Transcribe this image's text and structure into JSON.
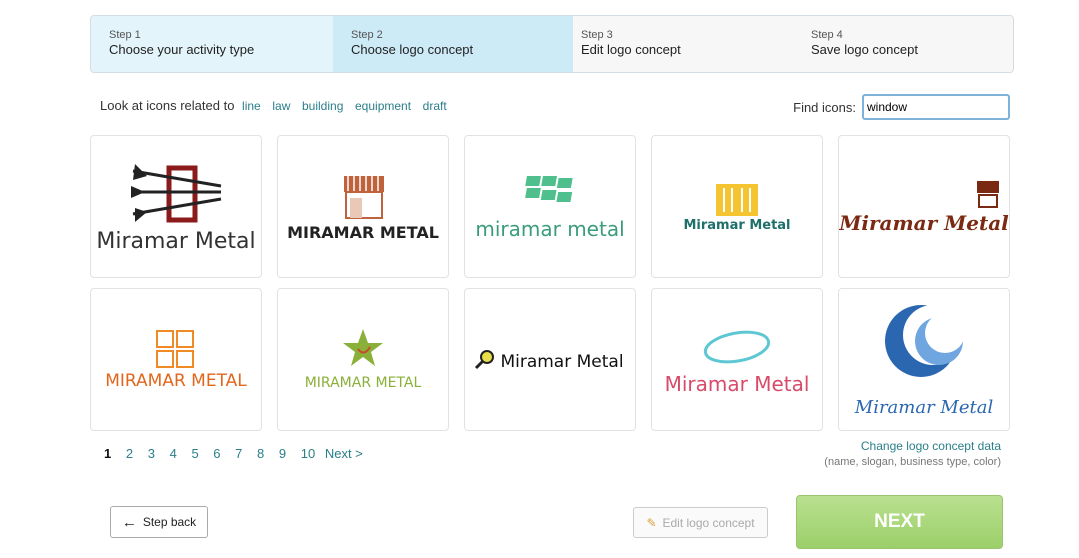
{
  "steps": [
    {
      "num": "Step 1",
      "label": "Choose your activity type"
    },
    {
      "num": "Step 2",
      "label": "Choose logo concept"
    },
    {
      "num": "Step 3",
      "label": "Edit logo concept"
    },
    {
      "num": "Step 4",
      "label": "Save logo concept"
    }
  ],
  "related": {
    "prefix": "Look at icons related to",
    "tags": [
      "line",
      "law",
      "building",
      "equipment",
      "draft"
    ]
  },
  "find": {
    "label": "Find icons:",
    "value": "window"
  },
  "logos": [
    {
      "text": "Miramar Metal",
      "color": "#333333"
    },
    {
      "text": "MIRAMAR METAL",
      "color": "#222222"
    },
    {
      "text": "miramar metal",
      "color": "#3a9c7d"
    },
    {
      "text": "Miramar Metal",
      "color": "#1f6f6a"
    },
    {
      "text": "Miramar Metal",
      "color": "#7a2a12"
    },
    {
      "text": "MIRAMAR METAL",
      "color": "#e2661c"
    },
    {
      "text": "MIRAMAR METAL",
      "color": "#8ab03a"
    },
    {
      "text": "Miramar Metal",
      "color": "#111111"
    },
    {
      "text": "Miramar Metal",
      "color": "#d94a68"
    },
    {
      "text": "Miramar Metal",
      "color": "#2b67b1"
    }
  ],
  "pager": {
    "pages": [
      "1",
      "2",
      "3",
      "4",
      "5",
      "6",
      "7",
      "8",
      "9",
      "10"
    ],
    "next": "Next >"
  },
  "change": {
    "link": "Change logo concept data",
    "sub": "(name, slogan, business type, color)"
  },
  "buttons": {
    "back": "Step back",
    "edit": "Edit logo concept",
    "next": "NEXT"
  }
}
